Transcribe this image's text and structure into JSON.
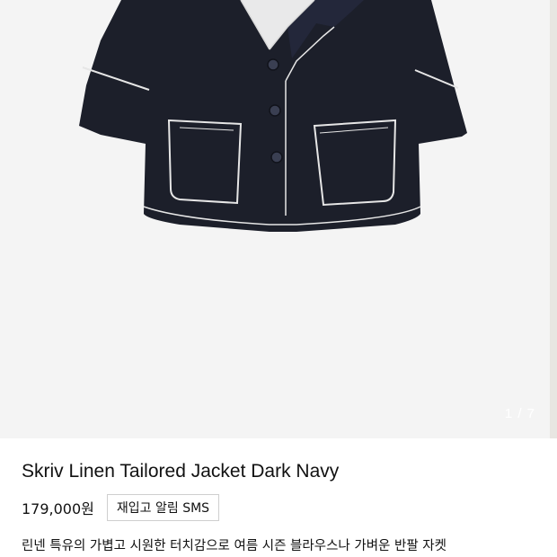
{
  "product": {
    "image_alt": "Skriv Linen Tailored Jacket Dark Navy product photo",
    "counter": "1 / 7",
    "title": "Skriv Linen Tailored Jacket Dark Navy",
    "price": "179,000원",
    "restock_label": "재입고 알림 SMS",
    "description": "린넨 특유의 가볍고 시원한 터치감으로 여름 시즌 블라우스나 가벼운 반팔 자켓"
  },
  "colors": {
    "background": "#f4f4f4",
    "jacket": "#1c1f2a",
    "stitching": "#e6e6e6"
  }
}
